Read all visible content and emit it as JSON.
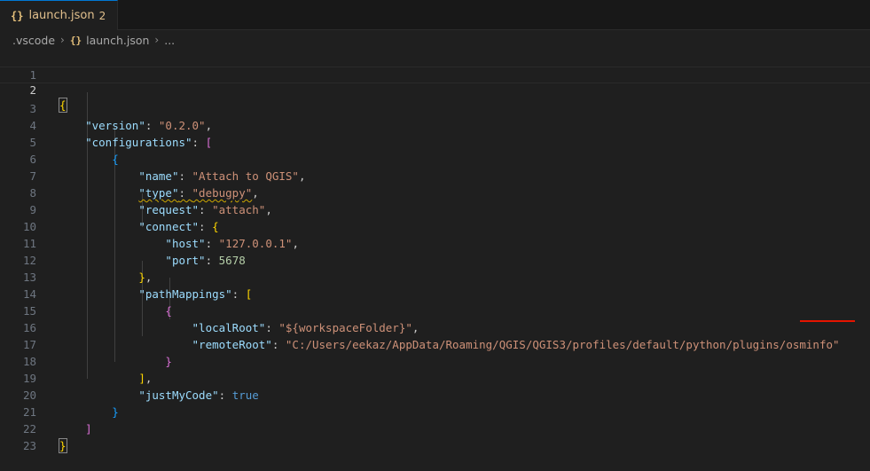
{
  "tab": {
    "icon": "json-braces-icon",
    "braces": "{}",
    "title": "launch.json",
    "problems": "2"
  },
  "breadcrumb": {
    "folder": ".vscode",
    "file": "launch.json",
    "more": "..."
  },
  "editor": {
    "line_numbers": [
      "1",
      "2",
      "3",
      "4",
      "5",
      "6",
      "7",
      "8",
      "9",
      "10",
      "11",
      "12",
      "13",
      "14",
      "15",
      "16",
      "17",
      "18",
      "19",
      "20",
      "21",
      "22",
      "23"
    ],
    "current_line": "2",
    "code": {
      "version_key": "\"version\"",
      "version_val": "\"0.2.0\"",
      "configurations_key": "\"configurations\"",
      "name_key": "\"name\"",
      "name_val": "\"Attach to QGIS\"",
      "type_key": "\"type\"",
      "type_val": "\"debugpy\"",
      "request_key": "\"request\"",
      "request_val": "\"attach\"",
      "connect_key": "\"connect\"",
      "host_key": "\"host\"",
      "host_val": "\"127.0.0.1\"",
      "port_key": "\"port\"",
      "port_val": "5678",
      "pathMappings_key": "\"pathMappings\"",
      "localRoot_key": "\"localRoot\"",
      "localRoot_val": "\"${workspaceFolder}\"",
      "remoteRoot_key": "\"remoteRoot\"",
      "remoteRoot_val_prefix": "\"C:/Users/eekaz/AppData/Roaming/QGIS/QGIS3/profiles/default/python/plugins/",
      "remoteRoot_val_highlight": "osminfo",
      "remoteRoot_val_suffix": "\"",
      "justMyCode_key": "\"justMyCode\"",
      "justMyCode_val": "true"
    }
  },
  "colors": {
    "background": "#1f1f1f",
    "key": "#9cdcfe",
    "string": "#ce9178",
    "number": "#b5cea8",
    "boolean": "#569cd6",
    "annotation_underline": "#e51400"
  }
}
